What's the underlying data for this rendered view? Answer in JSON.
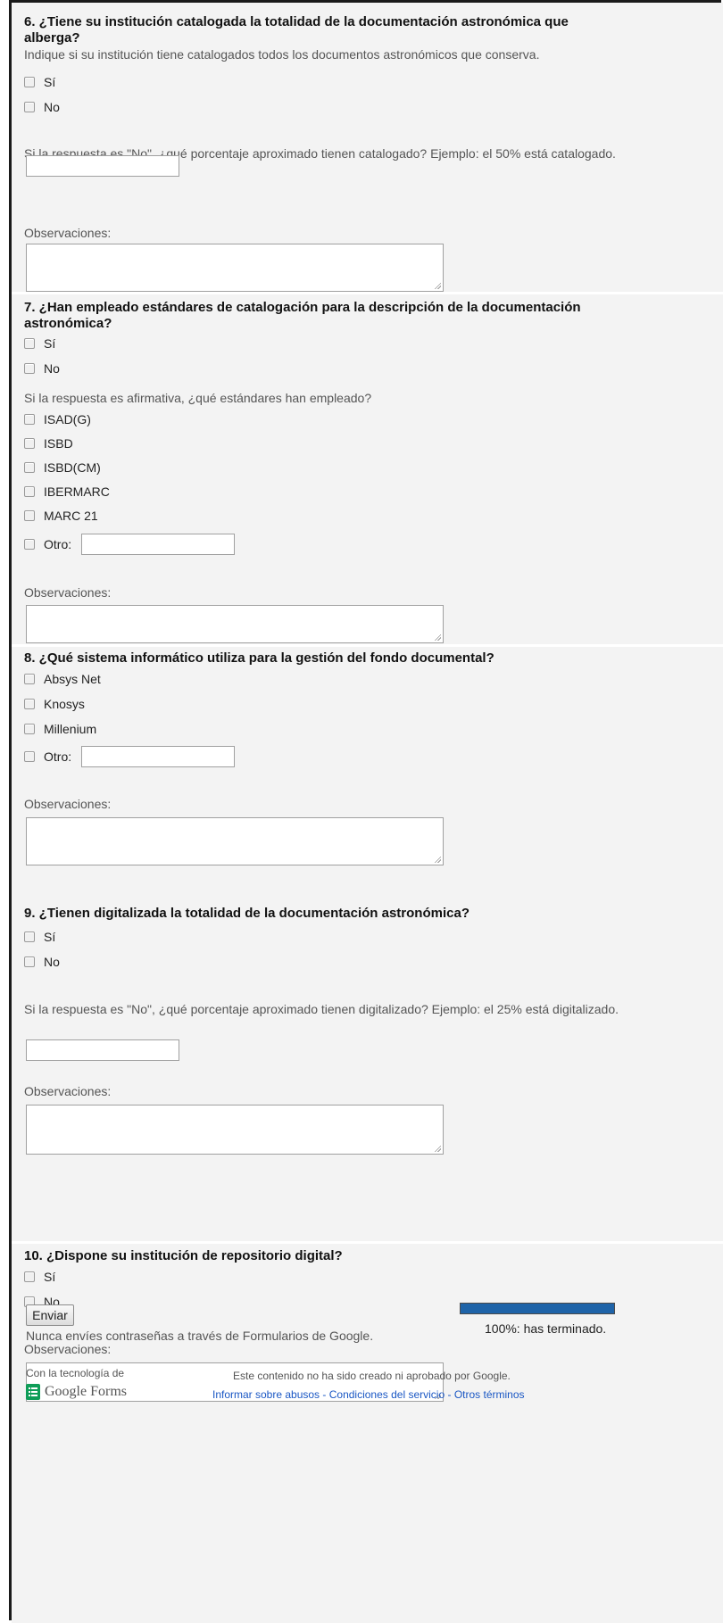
{
  "q6": {
    "title": "6. ¿Tiene su institución catalogada la totalidad de la documentación astronómica que alberga?",
    "help": "Indique si su institución tiene catalogados todos los documentos astronómicos que conserva.",
    "options": [
      "Sí",
      "No"
    ],
    "sub_question": "Si la respuesta es \"No\", ¿qué porcentaje aproximado tienen catalogado? Ejemplo: el 50% está catalogado.",
    "percent_value": "",
    "obs_label": "Observaciones:"
  },
  "q7": {
    "title": "7. ¿Han empleado estándares de catalogación para la descripción de la documentación astronómica?",
    "options": [
      "Sí",
      "No"
    ],
    "sub_question": "Si la respuesta es afirmativa, ¿qué estándares han empleado?",
    "standards": [
      "ISAD(G)",
      "ISBD",
      "ISBD(CM)",
      "IBERMARC",
      "MARC 21"
    ],
    "other_label": "Otro:",
    "obs_label": "Observaciones:"
  },
  "q8": {
    "title": "8. ¿Qué sistema informático utiliza para la gestión del fondo documental?",
    "options": [
      "Absys Net",
      "Knosys",
      "Millenium"
    ],
    "other_label": "Otro:",
    "obs_label": "Observaciones:"
  },
  "q9": {
    "title": "9. ¿Tienen digitalizada la totalidad de la documentación astronómica?",
    "options": [
      "Sí",
      "No"
    ],
    "sub_question": "Si la respuesta es \"No\", ¿qué porcentaje aproximado tienen digitalizado? Ejemplo: el 25% está digitalizado.",
    "obs_label": "Observaciones:"
  },
  "q10": {
    "title": "10. ¿Dispone su institución de repositorio digital?",
    "options": [
      "Sí",
      "No"
    ],
    "obs_label": "Observaciones:"
  },
  "submit": {
    "label": "Enviar",
    "warning": "Nunca envíes contraseñas a través de Formularios de Google."
  },
  "progress": {
    "percent": 100,
    "label": "100%: has terminado."
  },
  "footer": {
    "powered_by": "Con la tecnología de",
    "brand": "Google Forms",
    "disclaimer": "Este contenido no ha sido creado ni aprobado por Google.",
    "link_abuse": "Informar sobre abusos",
    "link_terms": "Condiciones del servicio",
    "link_other": "Otros términos",
    "link_sep": " - "
  },
  "colors": {
    "progress_fill": "#1e63a8",
    "link": "#1a57c4",
    "brand_green": "#0f9d58"
  }
}
